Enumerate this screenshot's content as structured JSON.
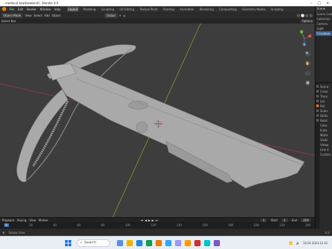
{
  "window": {
    "title": "...medieval bow\\bowbend] - Blender 4.0"
  },
  "topbar": {
    "menu": [
      "File",
      "Edit",
      "Render",
      "Window",
      "Help"
    ],
    "workspaces": [
      "Layout",
      "Modeling",
      "Sculpting",
      "UV Editing",
      "Texture Paint",
      "Shading",
      "Animation",
      "Rendering",
      "Compositing",
      "Geometry Nodes",
      "Scripting"
    ],
    "active_workspace": "Layout"
  },
  "viewport_header": {
    "mode": "Object Mode",
    "menus": [
      "View",
      "Select",
      "Add",
      "Object"
    ],
    "transform_orientation": "Global",
    "options": "Options"
  },
  "tool_header": {
    "select": "Select Box"
  },
  "viewport": {
    "background": "#3d3d3d",
    "axis_x_color": "#a33a48",
    "axis_y_color": "#7ea23a",
    "model_color": "#a9a9a9",
    "gizmo_x_label": "X",
    "gizmo_y_label": "Y",
    "gizmo_z_label": "Z"
  },
  "outliner": {
    "title": "Scene",
    "rows": [
      "Scene Collection",
      "Collection",
      "Camera",
      "Light",
      "Crossbow"
    ]
  },
  "properties": {
    "rows": [
      "Scene",
      "Cross",
      "Trans",
      "Loc",
      "Rot",
      "Scale",
      "Delta",
      "Relat",
      "Colle",
      "Insta",
      "Motio",
      "Visibi",
      "Viewp",
      "Line A",
      "Custom"
    ]
  },
  "timeline": {
    "menus": [
      "Playback",
      "Keying",
      "View",
      "Marker"
    ],
    "current_frame": "1",
    "start_label": "Start",
    "start": "1",
    "end_label": "End",
    "end": "250",
    "ruler": [
      "0",
      "20",
      "40",
      "60",
      "80",
      "100",
      "120",
      "140",
      "160",
      "180",
      "200",
      "220",
      "240"
    ]
  },
  "statusbar": {
    "hint": "Rotate View",
    "version": "4.0"
  },
  "taskbar": {
    "search_placeholder": "Search",
    "time": "10:24",
    "date": "2023-12-01"
  }
}
